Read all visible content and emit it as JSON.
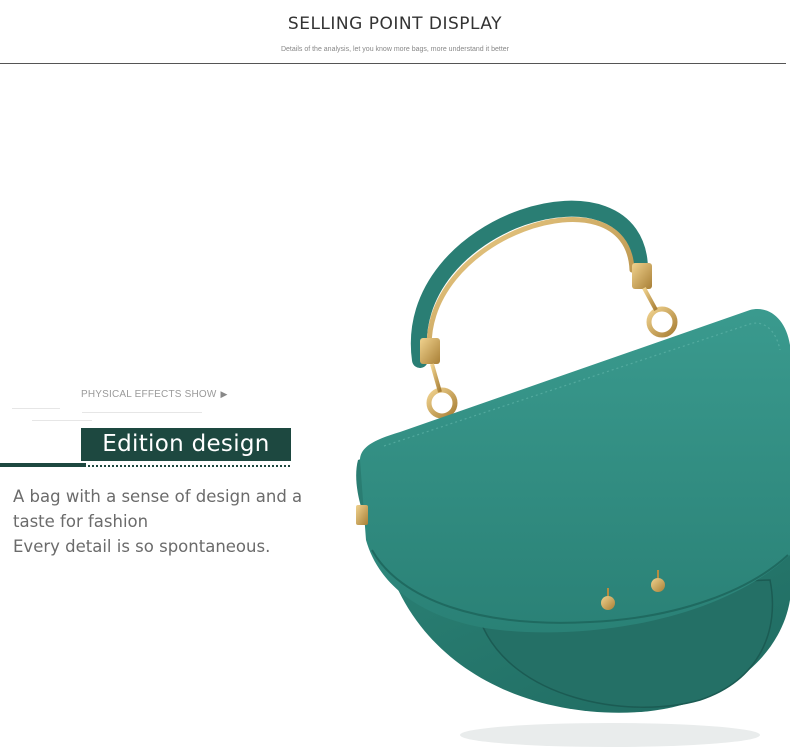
{
  "header": {
    "title": "SELLING POINT DISPLAY",
    "subtitle": "Details of the analysis, let you know more bags, more understand it better"
  },
  "section": {
    "label": "PHYSICAL EFFECTS SHOW",
    "heading": "Edition design",
    "description": [
      "A bag with a sense of design and a",
      "taste for fashion",
      "Every detail is so spontaneous."
    ]
  },
  "colors": {
    "accent": "#1d4840",
    "bag_teal": "#2f8b80",
    "hardware_gold": "#c9a45c"
  },
  "image": {
    "subject": "teal leather saddle handbag with gold metal handle",
    "icon": "handbag-photo"
  }
}
